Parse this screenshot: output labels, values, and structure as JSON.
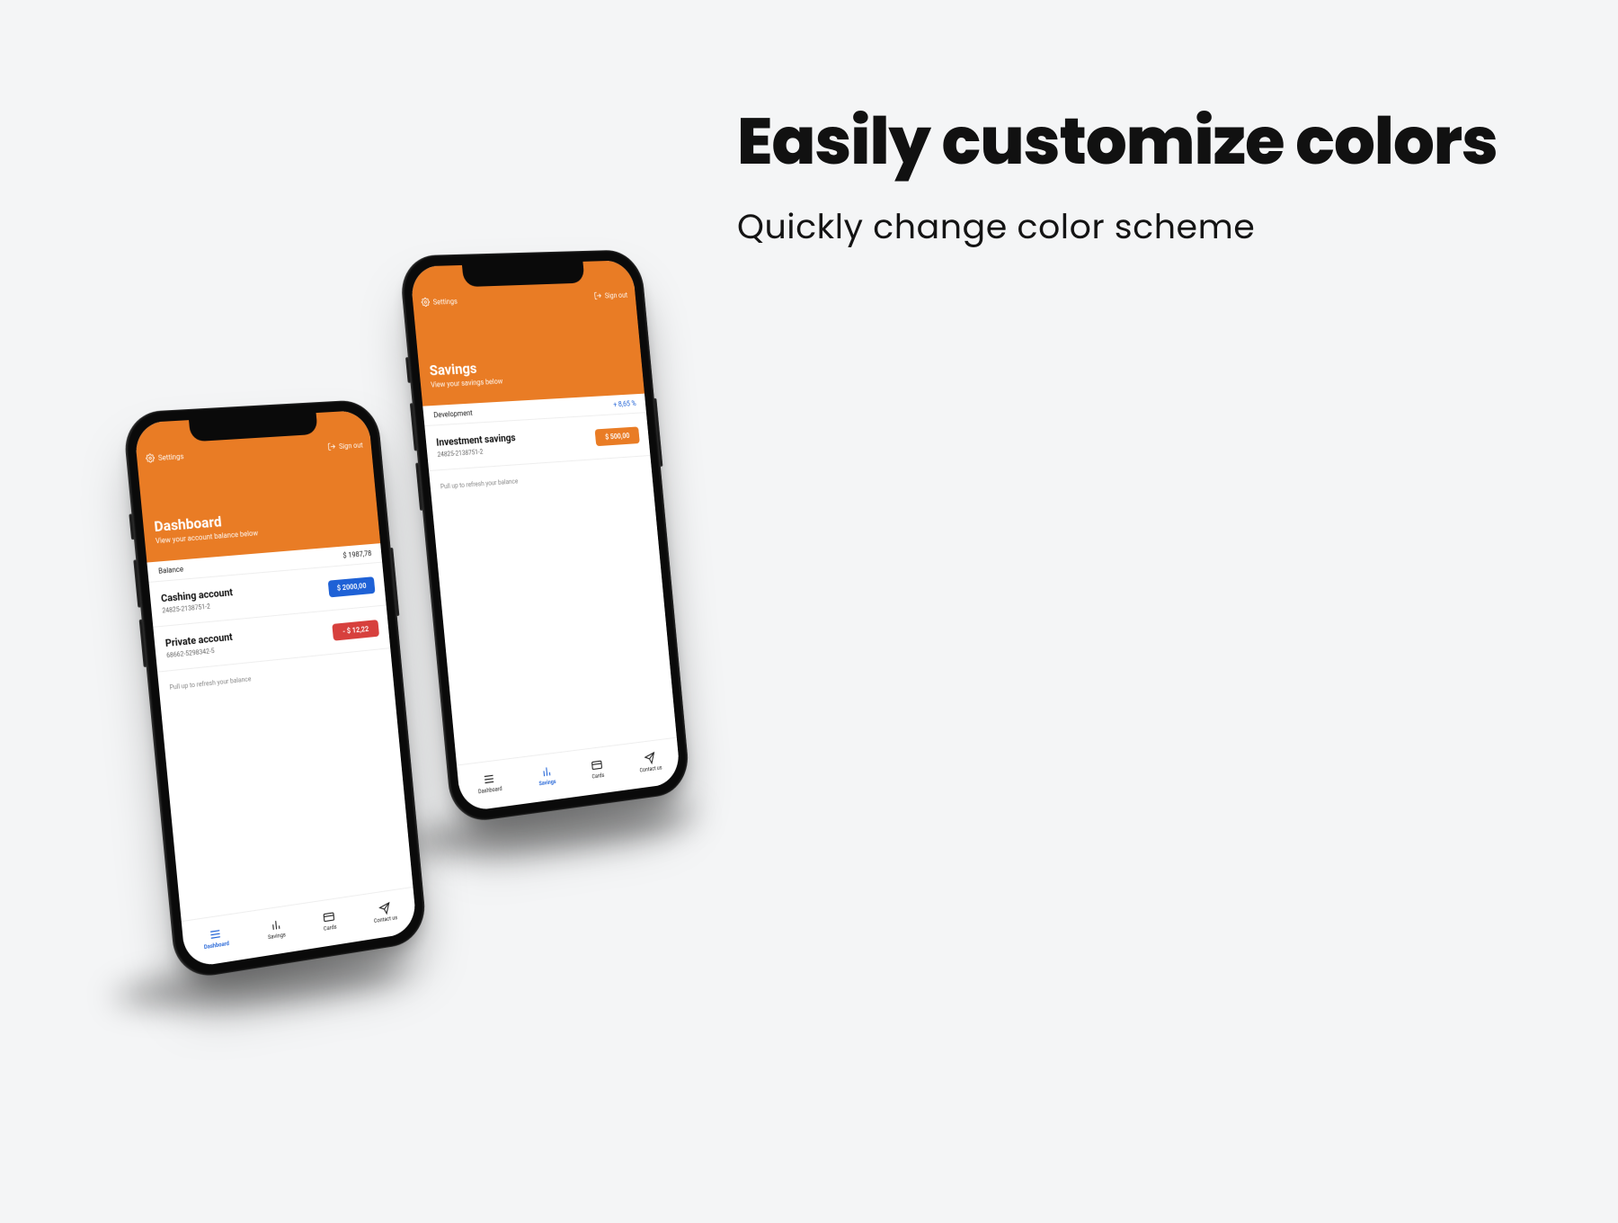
{
  "colors": {
    "accent": "#E97C25",
    "blue": "#1E61D6",
    "red": "#D7403D",
    "activeA": "#1E61D6"
  },
  "marketing": {
    "title": "Easily customize colors",
    "subtitle": "Quickly change color scheme"
  },
  "phoneA": {
    "settings_label": "Settings",
    "signout_label": "Sign out",
    "page_title": "Dashboard",
    "page_sub": "View your account balance below",
    "balance_label": "Balance",
    "balance_value": "$ 1987,78",
    "accounts": [
      {
        "name": "Cashing account",
        "num": "24825-2138751-2",
        "badge_text": "$ 2000,00",
        "badge_color": "#1E61D6"
      },
      {
        "name": "Private account",
        "num": "68662-5298342-5",
        "badge_text": "- $ 12,22",
        "badge_color": "#D7403D"
      }
    ],
    "refresh_text": "Pull up to refresh your balance",
    "tabs": [
      {
        "label": "Dashboard",
        "icon": "dashboard-icon",
        "active_color": "#1E61D6"
      },
      {
        "label": "Savings",
        "icon": "bars-icon",
        "active_color": null
      },
      {
        "label": "Cards",
        "icon": "card-icon",
        "active_color": null
      },
      {
        "label": "Contact us",
        "icon": "send-icon",
        "active_color": null
      }
    ]
  },
  "phoneB": {
    "settings_label": "Settings",
    "signout_label": "Sign out",
    "page_title": "Savings",
    "page_sub": "View your savings below",
    "strip_left": "Development",
    "strip_right": "+ 8,65 %",
    "strip_right_color": "#1E61D6",
    "account": {
      "name": "Investment savings",
      "num": "24825-2138751-2",
      "badge_text": "$ 500,00",
      "badge_color": "#E97C25"
    },
    "refresh_text": "Pull up to refresh your balance",
    "tabs": [
      {
        "label": "Dashboard",
        "icon": "dashboard-icon",
        "active_color": null
      },
      {
        "label": "Savings",
        "icon": "bars-icon",
        "active_color": "#1E61D6"
      },
      {
        "label": "Cards",
        "icon": "card-icon",
        "active_color": null
      },
      {
        "label": "Contact us",
        "icon": "send-icon",
        "active_color": null
      }
    ]
  }
}
